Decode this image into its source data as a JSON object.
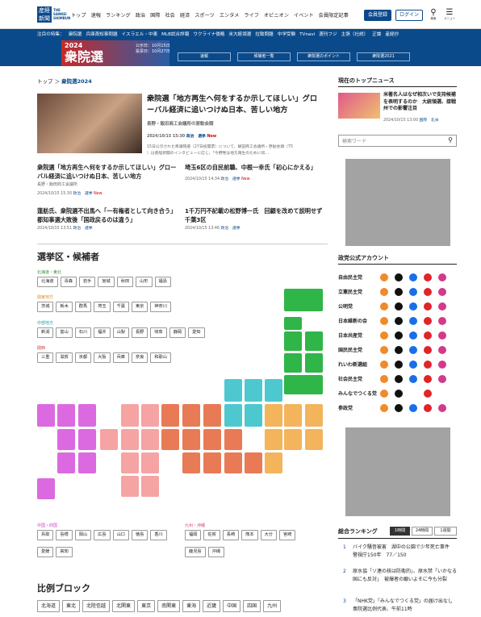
{
  "header": {
    "logo_kanji": "産経新聞",
    "logo_text": "THE SANKEI SHIMBUN",
    "nav": [
      "トップ",
      "速報",
      "ランキング",
      "政治",
      "国際",
      "社会",
      "経済",
      "スポーツ",
      "エンタメ",
      "ライフ",
      "オピニオン",
      "イベント",
      "会員限定記事"
    ],
    "register": "会員登録",
    "login": "ログイン",
    "search_label": "検索",
    "menu_label": "メニュー"
  },
  "subnav": {
    "label": "注目の特集：",
    "items": [
      "衆院選",
      "兵庫斎知事問題",
      "イスラエル・中東",
      "MLB試合詳報",
      "ウクライナ侵略",
      "米大統領選",
      "拉致問題",
      "中学受験",
      "TVnavi",
      "週刊フジ",
      "主張（社説）",
      "正論",
      "産経抄"
    ]
  },
  "banner": {
    "year": "2024",
    "title": "衆院選",
    "date1": "公示日：10月15日",
    "date2": "投票日：10月27日",
    "buttons": [
      "速報",
      "候補者一覧",
      "衆院選のポイント",
      "衆院選2021"
    ]
  },
  "breadcrumb": {
    "home": "トップ",
    "current": "衆院選2024"
  },
  "featured": {
    "title": "衆院選「地方再生へ何をするか示してほしい」グローバル経済に追いつけぬ日本、苦しい地方",
    "byline": "長野・飯田商工会議所の原勧会頭",
    "date": "2024/10/15 15:30",
    "tags": "政治　選挙",
    "new": "New",
    "excerpt1": "15日公示された衆議院選（27日投開票）について、飯田商工会議所・原勧会頭（75",
    "excerpt2": "）は産経新聞のインタビューに応じ、「今野党は地方再生のために何…"
  },
  "articles": [
    {
      "title": "衆院選「地方再生へ何をするか示してほしい」グローバル経済に追いつけぬ日本、苦しい地方",
      "byline": "長野・飯田商工会議所",
      "date": "2024/10/15 15:30",
      "tags": "政治　選挙",
      "new": "New"
    },
    {
      "title": "埼玉6区の自民前職、中根一幸氏「初心にかえる」",
      "byline": "",
      "date": "2024/10/15 14:34",
      "tags": "政治　選挙",
      "new": "New"
    },
    {
      "title": "蓮舫氏、衆院選不出馬へ「一有権者として向き合う」　都知事選大敗後「国政戻るのは違う」",
      "byline": "",
      "date": "2024/10/15 13:51",
      "tags": "政治　選挙",
      "new": ""
    },
    {
      "title": "1千万円不記載の松野博一氏　回顧を改めて説明せず　千葉3区",
      "byline": "",
      "date": "2024/10/15 13:46",
      "tags": "政治　選挙",
      "new": ""
    }
  ],
  "districts": {
    "title": "選挙区・候補者",
    "regions": [
      {
        "name": "北海道・東北",
        "color": "#2e8b3a",
        "prefs": [
          "北海道",
          "青森",
          "岩手",
          "宮城",
          "秋田",
          "山形",
          "福島"
        ]
      },
      {
        "name": "関東地方",
        "color": "#e08a2a",
        "prefs": [
          "茨城",
          "栃木",
          "群馬",
          "埼玉",
          "千葉",
          "東京",
          "神奈川"
        ]
      },
      {
        "name": "中部地方",
        "color": "#2a9ea8",
        "prefs": [
          "新潟",
          "富山",
          "石川",
          "福井",
          "山梨",
          "長野",
          "岐阜",
          "静岡",
          "愛知"
        ]
      },
      {
        "name": "関西",
        "color": "#d23a3a",
        "prefs": [
          "三重",
          "滋賀",
          "京都",
          "大阪",
          "兵庫",
          "奈良",
          "和歌山"
        ]
      },
      {
        "name": "中国・四国",
        "color": "#d43ad4",
        "prefs": [
          "鳥取",
          "島根",
          "岡山",
          "広島",
          "山口",
          "徳島",
          "香川",
          "愛媛",
          "高知"
        ]
      },
      {
        "name": "九州・沖縄",
        "color": "#e07a9a",
        "prefs": [
          "福岡",
          "佐賀",
          "長崎",
          "熊本",
          "大分",
          "宮崎",
          "鹿児島",
          "沖縄"
        ]
      }
    ]
  },
  "proportional": {
    "title": "比例ブロック",
    "blocks": [
      "北海道",
      "東北",
      "北陸信越",
      "北関東",
      "東京",
      "南関東",
      "東海",
      "近畿",
      "中国",
      "四国",
      "九州"
    ]
  },
  "sidebar": {
    "top_news": {
      "title": "現在のトップニュース",
      "headline": "米著名人はなぜ相次いで支持候補を表明するのか　大統領選、接戦州での影響注目",
      "date": "2024/10/15 13:00",
      "tags": "国際　北米"
    },
    "search_placeholder": "検索ワード",
    "parties_title": "政党公式アカウント",
    "parties": [
      "自由民主党",
      "立憲民主党",
      "公明党",
      "日本維新の会",
      "日本共産党",
      "国民民主党",
      "れいわ新選組",
      "社会民主党",
      "みんなでつくる党",
      "参政党"
    ],
    "ranking": {
      "title": "総合ランキング",
      "tabs": [
        "1時間",
        "24時間",
        "1週間"
      ],
      "items": [
        {
          "rank": "1",
          "text": "バイク騒音被害　湖中の公園で少年死亡事件　警視庁150年　77／150"
        },
        {
          "rank": "2",
          "text": "原水協「ソ連の核は防衛的」、原水禁「いかなる国にも反対」　被爆者の願いよそに今も分裂"
        },
        {
          "rank": "3",
          "text": "「NHK党」「みんなでつくる党」の届け出なし　衆院選比例代表、午前11時"
        }
      ]
    }
  },
  "colors": {
    "brand": "#0b4a8a",
    "hokkaido_tohoku": "#2fb548",
    "kanto": "#e87a56",
    "chubu": "#4ec8cf",
    "kansai": "#f5a3a3",
    "chugoku_shikoku": "#db6ae0",
    "kyushu": "#f3b45c",
    "new": "#dd0000"
  }
}
